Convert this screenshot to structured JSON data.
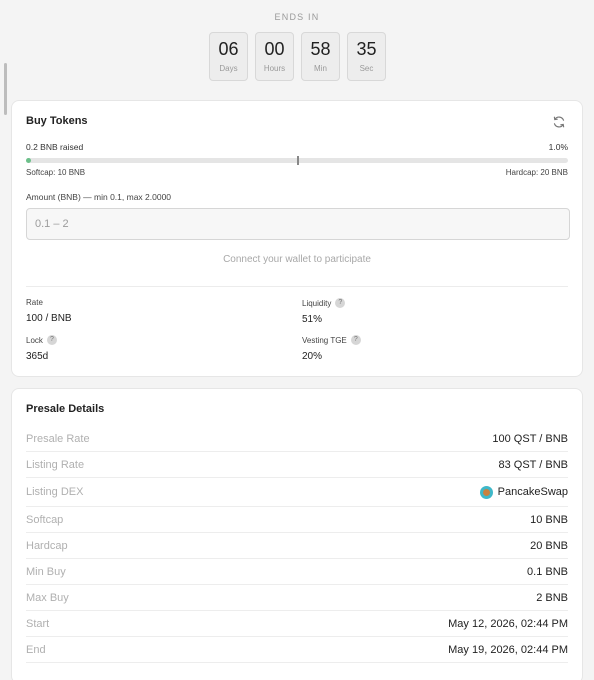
{
  "countdown": {
    "label": "ENDS IN",
    "units": [
      {
        "value": "06",
        "unit": "Days"
      },
      {
        "value": "00",
        "unit": "Hours"
      },
      {
        "value": "58",
        "unit": "Min"
      },
      {
        "value": "35",
        "unit": "Sec"
      }
    ]
  },
  "buy": {
    "title": "Buy Tokens",
    "refresh_icon": "refresh-icon",
    "raised_text": "0.2 BNB raised",
    "raised_percent_text": "1.0%",
    "progress_fraction": 0.01,
    "softcap_text": "Softcap: 10 BNB",
    "hardcap_text": "Hardcap: 20 BNB",
    "amount_label": "Amount (BNB) — min 0.1, max 2.0000",
    "amount_placeholder": "0.1 – 2",
    "amount_value": "",
    "connect_text": "Connect your wallet to participate",
    "stats": {
      "rate": {
        "label": "Rate",
        "value": "100 / BNB"
      },
      "liquidity": {
        "label": "Liquidity",
        "value": "51%",
        "help_icon": "help-icon"
      },
      "lock": {
        "label": "Lock",
        "value": "365d",
        "help_icon": "help-icon"
      },
      "vesting": {
        "label": "Vesting TGE",
        "value": "20%",
        "help_icon": "help-icon"
      }
    },
    "colors": {
      "progress": "#6cc08a"
    }
  },
  "details": {
    "title": "Presale Details",
    "rows": [
      {
        "label": "Presale Rate",
        "value": "100 QST / BNB"
      },
      {
        "label": "Listing Rate",
        "value": "83 QST / BNB"
      },
      {
        "label": "Listing DEX",
        "value": "PancakeSwap",
        "icon": "pancakeswap-logo-icon"
      },
      {
        "label": "Softcap",
        "value": "10 BNB"
      },
      {
        "label": "Hardcap",
        "value": "20 BNB"
      },
      {
        "label": "Min Buy",
        "value": "0.1 BNB"
      },
      {
        "label": "Max Buy",
        "value": "2 BNB"
      },
      {
        "label": "Start",
        "value": "May 12, 2026, 02:44 PM"
      },
      {
        "label": "End",
        "value": "May 19, 2026, 02:44 PM"
      }
    ]
  }
}
